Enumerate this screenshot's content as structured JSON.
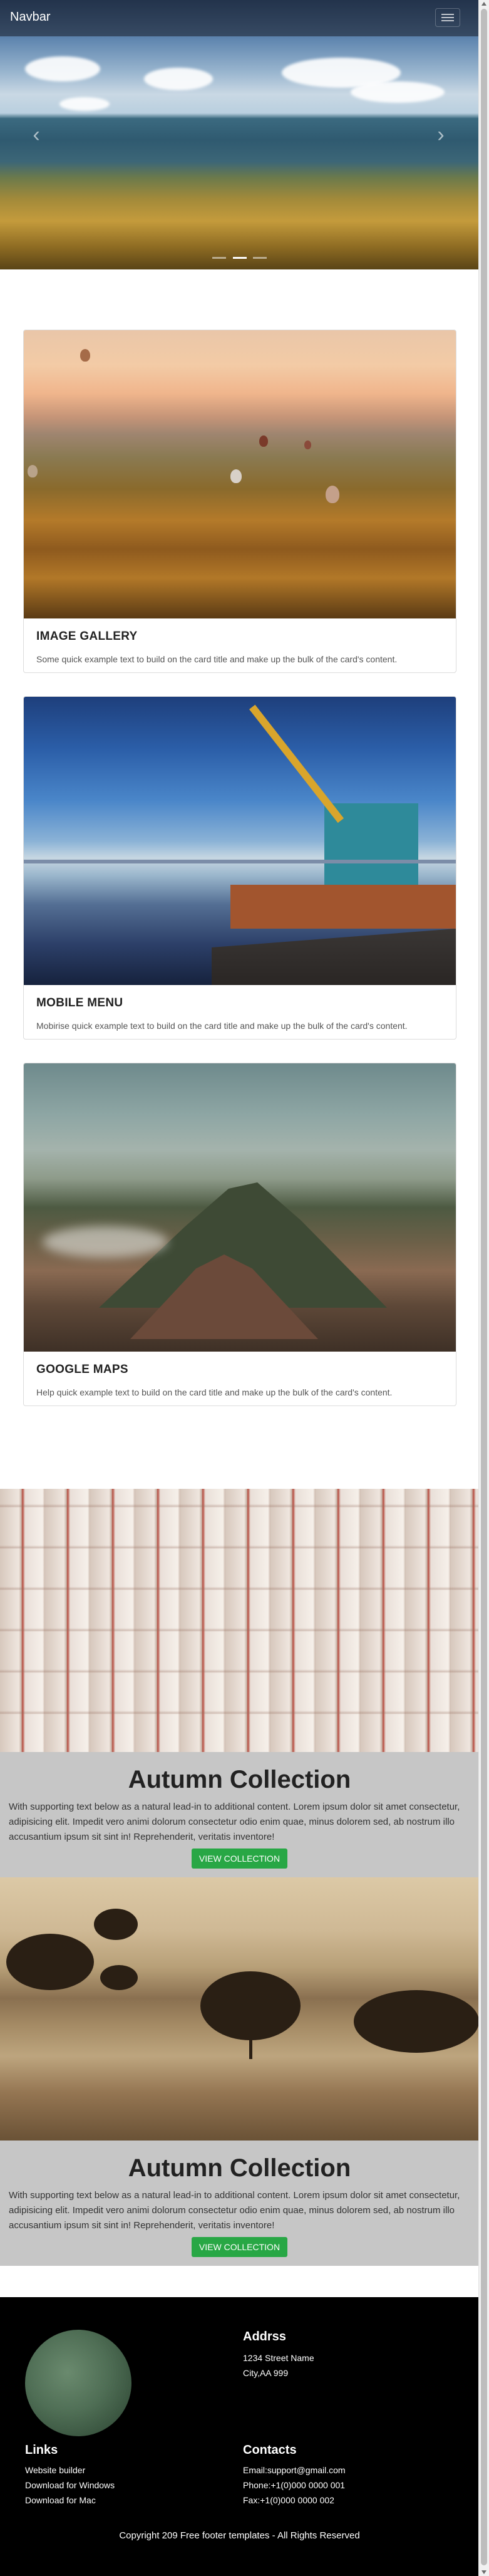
{
  "navbar": {
    "brand": "Navbar",
    "toggle_icon": "hamburger-icon"
  },
  "carousel": {
    "prev_icon": "chevron-left-icon",
    "next_icon": "chevron-right-icon",
    "slides": 3,
    "active_slide": 2
  },
  "cards": [
    {
      "title": "IMAGE GALLERY",
      "text": "Some quick example text to build on the card title and make up the bulk of the card's content."
    },
    {
      "title": "MOBILE MENU",
      "text": "Mobirise quick example text to build on the card title and make up the bulk of the card's content."
    },
    {
      "title": "GOOGLE MAPS",
      "text": "Help quick example text to build on the card title and make up the bulk of the card's content."
    }
  ],
  "collections": [
    {
      "title": "Autumn Collection",
      "text": "With supporting text below as a natural lead-in to additional content. Lorem ipsum dolor sit amet consectetur, adipisicing elit. Impedit vero animi dolorum consectetur odio enim quae, minus dolorem sed, ab nostrum illo accusantium ipsum sit sint in! Reprehenderit, veritatis inventore!",
      "button": "VIEW COLLECTION"
    },
    {
      "title": "Autumn Collection",
      "text": "With supporting text below as a natural lead-in to additional content. Lorem ipsum dolor sit amet consectetur, adipisicing elit. Impedit vero animi dolorum consectetur odio enim quae, minus dolorem sed, ab nostrum illo accusantium ipsum sit sint in! Reprehenderit, veritatis inventore!",
      "button": "VIEW COLLECTION"
    }
  ],
  "colors": {
    "button": "#28a745",
    "band": "#c6c6c6",
    "footer": "#000000"
  },
  "footer": {
    "address": {
      "heading": "Addrss",
      "line1": "1234 Street Name",
      "line2": "City,AA 999"
    },
    "links": {
      "heading": "Links",
      "items": [
        "Website builder",
        "Download for Windows",
        "Download for Mac"
      ]
    },
    "contacts": {
      "heading": "Contacts",
      "email": "Email:support@gmail.com",
      "phone": "Phone:+1(0)000 0000 001",
      "fax": "Fax:+1(0)000 0000 002"
    },
    "copyright": "Copyright 209 Free footer templates - All Rights Reserved"
  }
}
